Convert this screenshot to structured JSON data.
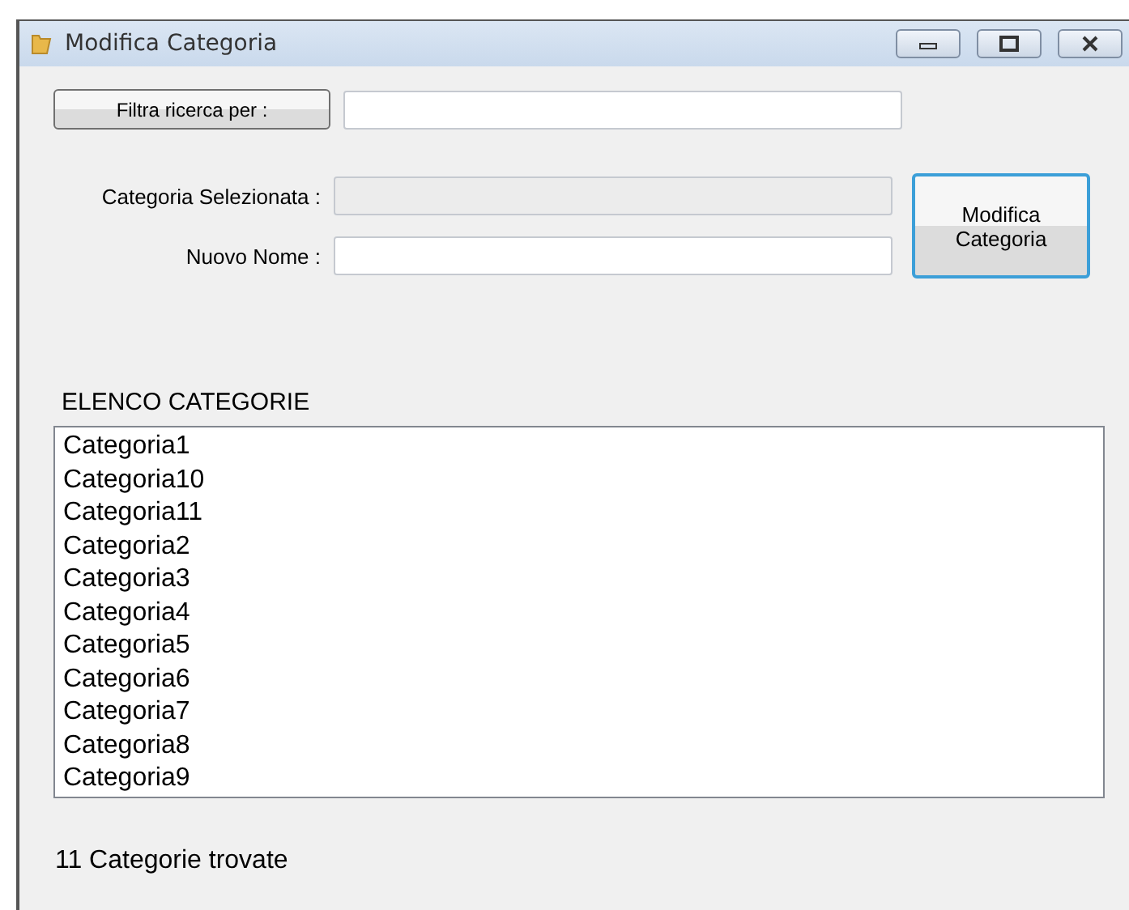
{
  "window": {
    "title": "Modifica Categoria"
  },
  "filter": {
    "button": "Filtra ricerca per :",
    "value_field": {
      "disabled": false
    }
  },
  "selected_category": {
    "label": "Categoria Selezionata :",
    "disabled": true
  },
  "new_name": {
    "label": "Nuovo Nome :",
    "disabled": false
  },
  "edit_button": {
    "label": "Modifica Categoria"
  },
  "list": {
    "title": "ELENCO CATEGORIE",
    "items": [
      {
        "label": "Categoria1",
        "selected": false
      },
      {
        "label": "Categoria10",
        "selected": false
      },
      {
        "label": "Categoria11",
        "selected": false
      },
      {
        "label": "Categoria2",
        "selected": false
      },
      {
        "label": "Categoria3",
        "selected": false
      },
      {
        "label": "Categoria4",
        "selected": false
      },
      {
        "label": "Categoria5",
        "selected": false
      },
      {
        "label": "Categoria6",
        "selected": false
      },
      {
        "label": "Categoria7",
        "selected": false
      },
      {
        "label": "Categoria8",
        "selected": false
      },
      {
        "label": "Categoria9",
        "selected": false
      }
    ]
  },
  "status": "11 Categorie trovate"
}
